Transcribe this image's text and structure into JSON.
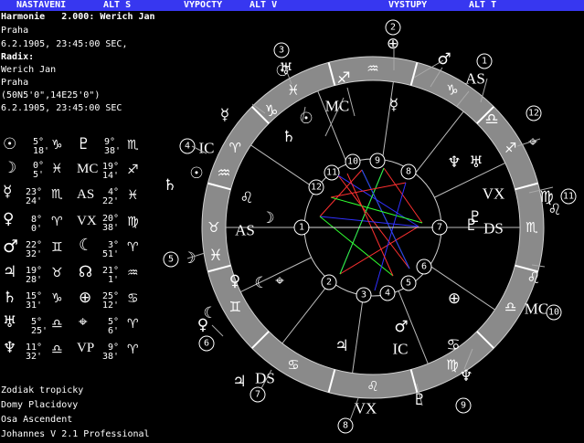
{
  "menu": {
    "nastaveni": "NASTAVENI",
    "alt_s": "ALT S",
    "vypocty": "VYPOCTY",
    "alt_v": "ALT V",
    "vystupy": "VYSTUPY",
    "alt_t": "ALT T"
  },
  "info": {
    "harmonie": "Harmonie   2.000: Werich Jan",
    "place1": "Praha",
    "date1": "6.2.1905, 23:45:00 SEC,",
    "radix_label": "Radix:",
    "name": "Werich Jan",
    "place2": "Praha",
    "coords": "(50N5'0\",14E25'0\")",
    "date2": "6.2.1905, 23:45:00 SEC"
  },
  "planets": {
    "left": [
      {
        "sym": "☉",
        "deg": "5°",
        "min": "18'",
        "sign": "♑"
      },
      {
        "sym": "☽",
        "deg": "0°",
        "min": "5'",
        "sign": "♓"
      },
      {
        "sym": "☿",
        "deg": "23°",
        "min": "24'",
        "sign": "♏"
      },
      {
        "sym": "♀",
        "deg": "8°",
        "min": "0'",
        "sign": "♈"
      },
      {
        "sym": "♂",
        "deg": "22°",
        "min": "32'",
        "sign": "♊"
      },
      {
        "sym": "♃",
        "deg": "19°",
        "min": "28'",
        "sign": "♉"
      },
      {
        "sym": "♄",
        "deg": "15°",
        "min": "31'",
        "sign": "♑"
      },
      {
        "sym": "♅",
        "deg": "5°",
        "min": "25'",
        "sign": "♎"
      },
      {
        "sym": "♆",
        "deg": "11°",
        "min": "32'",
        "sign": "♎"
      }
    ],
    "right": [
      {
        "sym": "♇",
        "deg": "9°",
        "min": "38'",
        "sign": "♏"
      },
      {
        "sym": "MC",
        "deg": "19°",
        "min": "14'",
        "sign": "♐"
      },
      {
        "sym": "AS",
        "deg": "4°",
        "min": "22'",
        "sign": "♓"
      },
      {
        "sym": "VX",
        "deg": "20°",
        "min": "38'",
        "sign": "♍"
      },
      {
        "sym": "☾",
        "deg": "3°",
        "min": "51'",
        "sign": "♈"
      },
      {
        "sym": "☊",
        "deg": "21°",
        "min": "1'",
        "sign": "♒"
      },
      {
        "sym": "⊕",
        "deg": "25°",
        "min": "12'",
        "sign": "♋"
      },
      {
        "sym": "⌖",
        "deg": "5°",
        "min": "6'",
        "sign": "♈"
      },
      {
        "sym": "VP",
        "deg": "9°",
        "min": "38'",
        "sign": "♈"
      }
    ]
  },
  "footer": {
    "zodiac": "Zodiak tropicky",
    "houses": "Domy Placidovy",
    "axis": "Osa Ascendent",
    "version": "Johannes V 2.1 Professional"
  },
  "wheel": {
    "ring_color": "#8a8a8a",
    "aspect_colors": [
      "#ff3030",
      "#3030ff",
      "#30ff30"
    ],
    "house_numbers": [
      "1",
      "2",
      "3",
      "4",
      "5",
      "6",
      "7",
      "8",
      "9",
      "10",
      "11",
      "12"
    ],
    "zodiac_signs": [
      "♐",
      "♑",
      "♒",
      "♓",
      "♈",
      "♉",
      "♊",
      "♋",
      "♌",
      "♍",
      "♎",
      "♏"
    ],
    "outer_labels": {
      "as_right": "AS",
      "mc_top": "MC",
      "ic_left": "IC",
      "vx_right": "VX",
      "mc_right": "MC",
      "ic_bottom": "IC",
      "vx_bottom": "VX",
      "ds_bottom": "DS"
    },
    "inner_labels": {
      "as": "AS",
      "mc": "MC",
      "ds": "DS",
      "pluto": "♇"
    }
  }
}
